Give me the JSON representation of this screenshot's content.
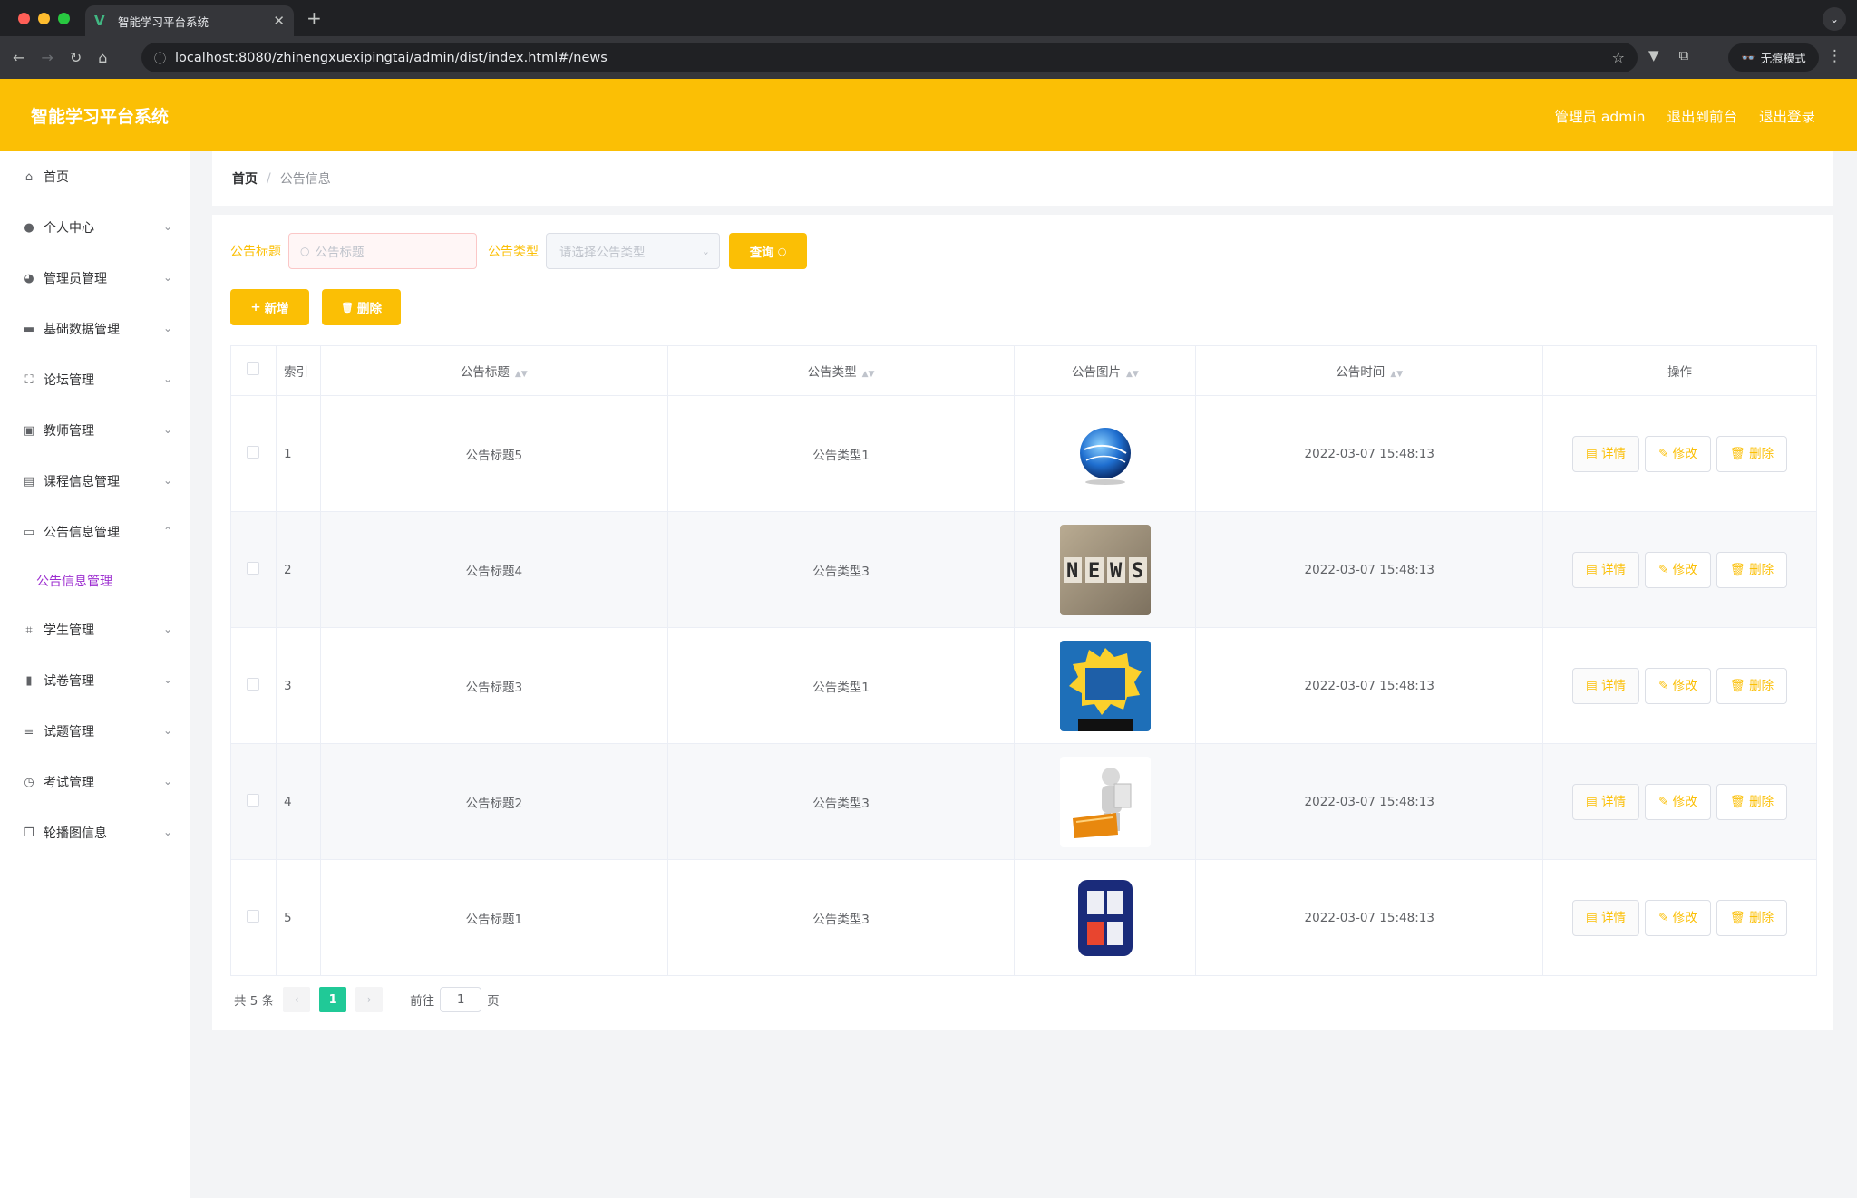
{
  "browser": {
    "tab_title": "智能学习平台系统",
    "url": "localhost:8080/zhinengxuexipingtai/admin/dist/index.html#/news",
    "incognito_label": "无痕模式"
  },
  "header": {
    "brand": "智能学习平台系统",
    "user_label": "管理员 admin",
    "front_link": "退出到前台",
    "logout_link": "退出登录",
    "color": "#fbbf05"
  },
  "sidebar": {
    "items": [
      {
        "label": "首页",
        "icon": "home-icon",
        "expandable": false
      },
      {
        "label": "个人中心",
        "icon": "user-icon",
        "expandable": true
      },
      {
        "label": "管理员管理",
        "icon": "admin-icon",
        "expandable": true
      },
      {
        "label": "基础数据管理",
        "icon": "data-icon",
        "expandable": true
      },
      {
        "label": "论坛管理",
        "icon": "forum-icon",
        "expandable": true
      },
      {
        "label": "教师管理",
        "icon": "teacher-icon",
        "expandable": true
      },
      {
        "label": "课程信息管理",
        "icon": "course-icon",
        "expandable": true
      },
      {
        "label": "公告信息管理",
        "icon": "notice-icon",
        "expandable": true,
        "open": true
      },
      {
        "label": "学生管理",
        "icon": "student-icon",
        "expandable": true
      },
      {
        "label": "试卷管理",
        "icon": "chart-icon",
        "expandable": true
      },
      {
        "label": "试题管理",
        "icon": "list-icon",
        "expandable": true
      },
      {
        "label": "考试管理",
        "icon": "exam-icon",
        "expandable": true
      },
      {
        "label": "轮播图信息",
        "icon": "carousel-icon",
        "expandable": true
      }
    ],
    "active_sub": "公告信息管理"
  },
  "breadcrumb": {
    "home": "首页",
    "current": "公告信息"
  },
  "search": {
    "title_label": "公告标题",
    "title_placeholder": "公告标题",
    "type_label": "公告类型",
    "type_placeholder": "请选择公告类型",
    "query_button": "查询"
  },
  "actions": {
    "add": "新增",
    "delete": "删除"
  },
  "table": {
    "headers": {
      "index": "索引",
      "title": "公告标题",
      "type": "公告类型",
      "image": "公告图片",
      "time": "公告时间",
      "ops": "操作"
    },
    "op_labels": {
      "detail": "详情",
      "edit": "修改",
      "delete": "删除"
    },
    "rows": [
      {
        "index": "1",
        "title": "公告标题5",
        "type": "公告类型1",
        "image": "globe-news-image",
        "time": "2022-03-07 15:48:13"
      },
      {
        "index": "2",
        "title": "公告标题4",
        "type": "公告类型3",
        "image": "news-blocks-image",
        "time": "2022-03-07 15:48:13"
      },
      {
        "index": "3",
        "title": "公告标题3",
        "type": "公告类型1",
        "image": "breaking-news-image",
        "time": "2022-03-07 15:48:13"
      },
      {
        "index": "4",
        "title": "公告标题2",
        "type": "公告类型3",
        "image": "figure-news-image",
        "time": "2022-03-07 15:48:13"
      },
      {
        "index": "5",
        "title": "公告标题1",
        "type": "公告类型3",
        "image": "cctv-news-image",
        "time": "2022-03-07 15:48:13"
      }
    ]
  },
  "pagination": {
    "total": "共 5 条",
    "current": "1",
    "goto": "前往",
    "goto_value": "1",
    "page_unit": "页"
  }
}
